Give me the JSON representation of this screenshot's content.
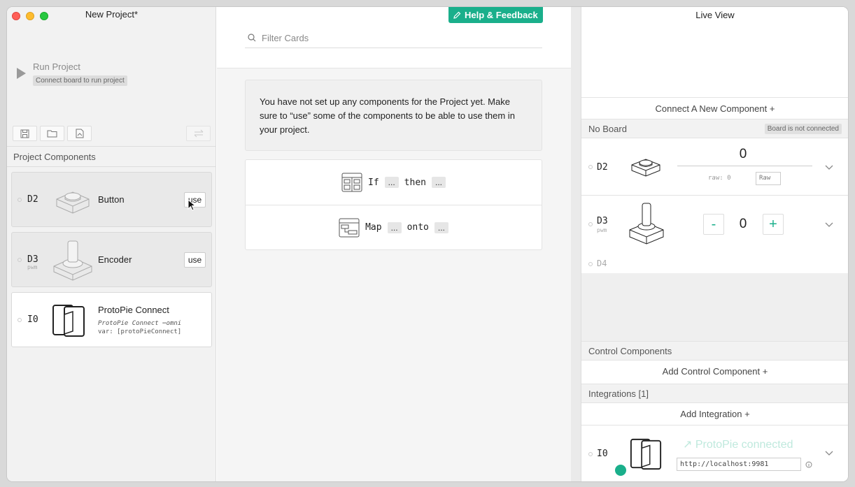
{
  "left": {
    "window_title": "New Project*",
    "run": {
      "label": "Run Project",
      "hint": "Connect board to run project"
    },
    "section_title": "Project Components",
    "components": [
      {
        "pin": "D2",
        "pin_sub": "",
        "name": "Button",
        "action": "use"
      },
      {
        "pin": "D3",
        "pin_sub": "pwm",
        "name": "Encoder",
        "action": "use"
      },
      {
        "pin": "I0",
        "pin_sub": "",
        "name": "ProtoPie Connect",
        "subtitle": "ProtoPie Connect ⋯omni",
        "var_line": "var: [protoPieConnect]"
      }
    ]
  },
  "middle": {
    "help_label": "Help & Feedback",
    "filter_placeholder": "Filter Cards",
    "notice": "You have not set up any components for the Project yet. Make sure to “use” some of the components to be able to use them in your project.",
    "cards": [
      {
        "kw1": "If",
        "slot1": "...",
        "kw2": "then",
        "slot2": "..."
      },
      {
        "kw1": "Map",
        "slot1": "...",
        "kw2": "onto",
        "slot2": "..."
      }
    ]
  },
  "right": {
    "title": "Live View",
    "connect_component": "Connect A New Component +",
    "board_label": "No Board",
    "board_status": "Board is not connected",
    "d2": {
      "pin": "D2",
      "value": "0",
      "raw_text": "raw: 0",
      "raw_button": "Raw"
    },
    "d3": {
      "pin": "D3",
      "pin_sub": "pwm",
      "value": "0",
      "minus": "-",
      "plus": "+"
    },
    "d4": {
      "pin": "D4"
    },
    "control_title": "Control Components",
    "add_control": "Add Control Component +",
    "integrations_title": "Integrations [1]",
    "add_integration": "Add Integration +",
    "i0": {
      "pin": "I0",
      "status": "↗ ProtoPie connected",
      "url": "http://localhost:9981"
    }
  },
  "colors": {
    "accent": "#1aaf8b",
    "panel": "#f2f2f2"
  }
}
